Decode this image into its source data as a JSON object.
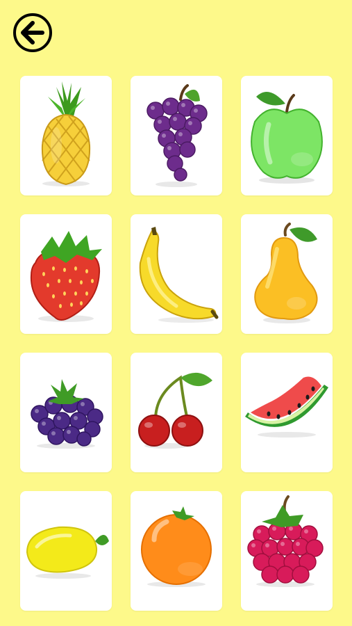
{
  "header": {
    "back_icon": "arrow-left-circle-icon"
  },
  "fruits": [
    {
      "name": "pineapple",
      "icon": "pineapple-icon"
    },
    {
      "name": "grapes",
      "icon": "grapes-icon"
    },
    {
      "name": "green-apple",
      "icon": "green-apple-icon"
    },
    {
      "name": "strawberry",
      "icon": "strawberry-icon"
    },
    {
      "name": "banana",
      "icon": "banana-icon"
    },
    {
      "name": "pear",
      "icon": "pear-icon"
    },
    {
      "name": "blackberry",
      "icon": "blackberry-icon"
    },
    {
      "name": "cherries",
      "icon": "cherries-icon"
    },
    {
      "name": "watermelon-slice",
      "icon": "watermelon-slice-icon"
    },
    {
      "name": "lemon",
      "icon": "lemon-icon"
    },
    {
      "name": "orange",
      "icon": "orange-icon"
    },
    {
      "name": "raspberry",
      "icon": "raspberry-icon"
    }
  ],
  "colors": {
    "background": "#fdf98a",
    "card": "#ffffff",
    "back_button_fill": "#fdf98a",
    "back_button_stroke": "#000000"
  }
}
